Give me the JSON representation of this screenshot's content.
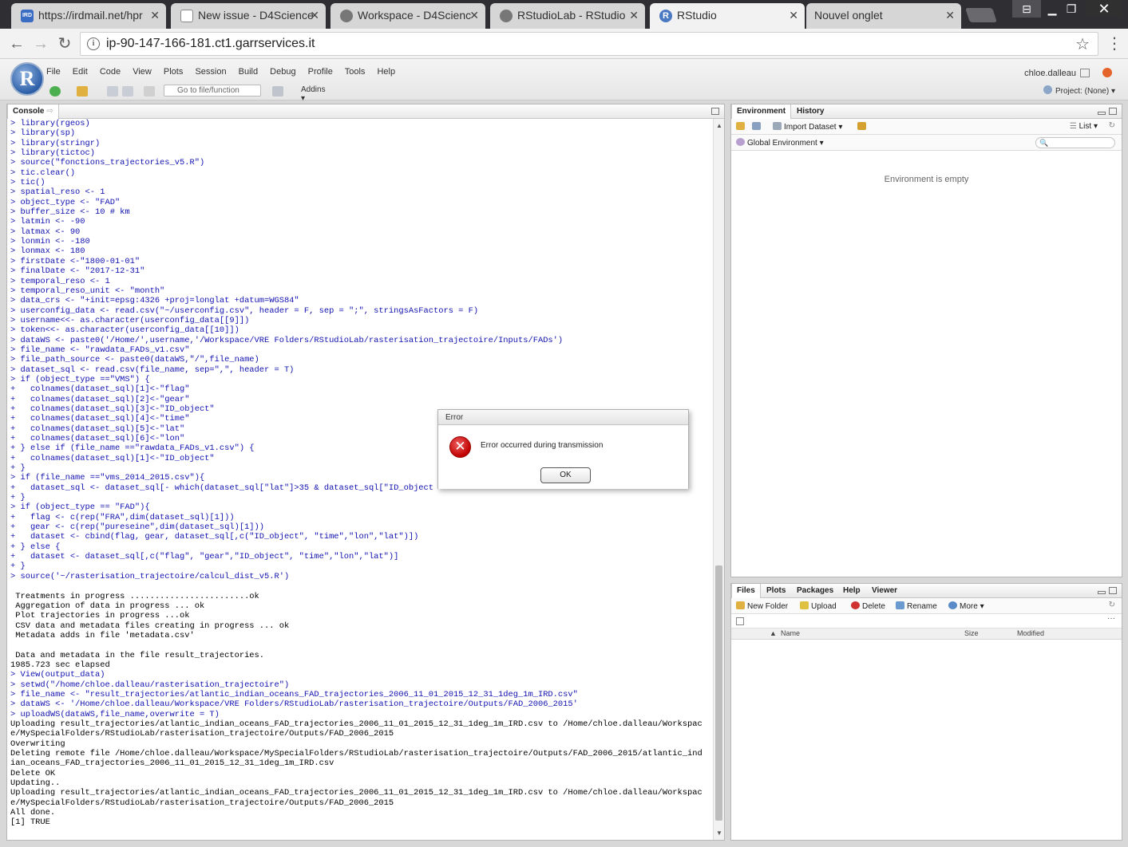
{
  "browser": {
    "tabs": [
      {
        "title": "https://irdmail.net/hpr",
        "icon_color": "#3b6cc4",
        "icon_text": "IRD"
      },
      {
        "title": "New issue - D4Science",
        "icon_color": "#ffffff",
        "icon_text": ""
      },
      {
        "title": "Workspace - D4Scienc",
        "icon_color": "#777777",
        "icon_text": ""
      },
      {
        "title": "RStudioLab - RStudio",
        "icon_color": "#777777",
        "icon_text": ""
      },
      {
        "title": "RStudio",
        "icon_color": "#4a78c2",
        "icon_text": "R"
      },
      {
        "title": "Nouvel onglet",
        "icon_color": "",
        "icon_text": ""
      }
    ],
    "url": "ip-90-147-166-181.ct1.garrservices.it"
  },
  "rstudio": {
    "logo": "R",
    "menu": [
      "File",
      "Edit",
      "Code",
      "View",
      "Plots",
      "Session",
      "Build",
      "Debug",
      "Profile",
      "Tools",
      "Help"
    ],
    "goto_placeholder": "Go to file/function",
    "addins": "Addins",
    "user": "chloe.dalleau",
    "project": "Project: (None)",
    "console_tab": "Console",
    "env_tabs": [
      "Environment",
      "History"
    ],
    "import_dataset": "Import Dataset",
    "list_view": "List",
    "global_env": "Global Environment",
    "env_empty": "Environment is empty",
    "files_tabs": [
      "Files",
      "Plots",
      "Packages",
      "Help",
      "Viewer"
    ],
    "files_toolbar": {
      "new_folder": "New Folder",
      "upload": "Upload",
      "delete": "Delete",
      "rename": "Rename",
      "more": "More"
    },
    "files_columns": {
      "name": "Name",
      "size": "Size",
      "modified": "Modified"
    }
  },
  "console_lines": [
    {
      "t": "> library(rgeos)",
      "c": 1
    },
    {
      "t": "> library(sp)",
      "c": 1
    },
    {
      "t": "> library(stringr)",
      "c": 1
    },
    {
      "t": "> library(tictoc)",
      "c": 1
    },
    {
      "t": "> source(\"fonctions_trajectories_v5.R\")",
      "c": 1
    },
    {
      "t": "> tic.clear()",
      "c": 1
    },
    {
      "t": "> tic()",
      "c": 1
    },
    {
      "t": "> spatial_reso <- 1",
      "c": 1
    },
    {
      "t": "> object_type <- \"FAD\"",
      "c": 1
    },
    {
      "t": "> buffer_size <- 10 # km",
      "c": 1
    },
    {
      "t": "> latmin <- -90",
      "c": 1
    },
    {
      "t": "> latmax <- 90",
      "c": 1
    },
    {
      "t": "> lonmin <- -180",
      "c": 1
    },
    {
      "t": "> lonmax <- 180",
      "c": 1
    },
    {
      "t": "> firstDate <-\"1800-01-01\"",
      "c": 1
    },
    {
      "t": "> finalDate <- \"2017-12-31\"",
      "c": 1
    },
    {
      "t": "> temporal_reso <- 1",
      "c": 1
    },
    {
      "t": "> temporal_reso_unit <- \"month\"",
      "c": 1
    },
    {
      "t": "> data_crs <- \"+init=epsg:4326 +proj=longlat +datum=WGS84\"",
      "c": 1
    },
    {
      "t": "> userconfig_data <- read.csv(\"~/userconfig.csv\", header = F, sep = \";\", stringsAsFactors = F)",
      "c": 1
    },
    {
      "t": "> username<<- as.character(userconfig_data[[9]])",
      "c": 1
    },
    {
      "t": "> token<<- as.character(userconfig_data[[10]])",
      "c": 1
    },
    {
      "t": "> dataWS <- paste0('/Home/',username,'/Workspace/VRE Folders/RStudioLab/rasterisation_trajectoire/Inputs/FADs')",
      "c": 1
    },
    {
      "t": "> file_name <- \"rawdata_FADs_v1.csv\"",
      "c": 1
    },
    {
      "t": "> file_path_source <- paste0(dataWS,\"/\",file_name)",
      "c": 1
    },
    {
      "t": "> dataset_sql <- read.csv(file_name, sep=\",\", header = T)",
      "c": 1
    },
    {
      "t": "> if (object_type ==\"VMS\") {",
      "c": 1
    },
    {
      "t": "+   colnames(dataset_sql)[1]<-\"flag\"",
      "c": 1
    },
    {
      "t": "+   colnames(dataset_sql)[2]<-\"gear\"",
      "c": 1
    },
    {
      "t": "+   colnames(dataset_sql)[3]<-\"ID_object\"",
      "c": 1
    },
    {
      "t": "+   colnames(dataset_sql)[4]<-\"time\"",
      "c": 1
    },
    {
      "t": "+   colnames(dataset_sql)[5]<-\"lat\"",
      "c": 1
    },
    {
      "t": "+   colnames(dataset_sql)[6]<-\"lon\"",
      "c": 1
    },
    {
      "t": "+ } else if (file_name ==\"rawdata_FADs_v1.csv\") {",
      "c": 1
    },
    {
      "t": "+   colnames(dataset_sql)[1]<-\"ID_object\"",
      "c": 1
    },
    {
      "t": "+ }",
      "c": 1
    },
    {
      "t": "> if (file_name ==\"vms_2014_2015.csv\"){",
      "c": 1
    },
    {
      "t": "+   dataset_sql <- dataset_sql[- which(dataset_sql[\"lat\"]>35 & dataset_sql[\"ID_object",
      "c": 1
    },
    {
      "t": "+ }",
      "c": 1
    },
    {
      "t": "> if (object_type == \"FAD\"){",
      "c": 1
    },
    {
      "t": "+   flag <- c(rep(\"FRA\",dim(dataset_sql)[1]))",
      "c": 1
    },
    {
      "t": "+   gear <- c(rep(\"pureseine\",dim(dataset_sql)[1]))",
      "c": 1
    },
    {
      "t": "+   dataset <- cbind(flag, gear, dataset_sql[,c(\"ID_object\", \"time\",\"lon\",\"lat\")])",
      "c": 1
    },
    {
      "t": "+ } else {",
      "c": 1
    },
    {
      "t": "+   dataset <- dataset_sql[,c(\"flag\", \"gear\",\"ID_object\", \"time\",\"lon\",\"lat\")]",
      "c": 1
    },
    {
      "t": "+ }",
      "c": 1
    },
    {
      "t": "> source('~/rasterisation_trajectoire/calcul_dist_v5.R')",
      "c": 1
    },
    {
      "t": "",
      "c": 0
    },
    {
      "t": " Treatments in progress ........................ok",
      "c": 0
    },
    {
      "t": " Aggregation of data in progress ... ok",
      "c": 0
    },
    {
      "t": " Plot trajectories in progress ...ok",
      "c": 0
    },
    {
      "t": " CSV data and metadata files creating in progress ... ok",
      "c": 0
    },
    {
      "t": " Metadata adds in file 'metadata.csv'",
      "c": 0
    },
    {
      "t": "",
      "c": 0
    },
    {
      "t": " Data and metadata in the file result_trajectories.",
      "c": 0
    },
    {
      "t": "1985.723 sec elapsed",
      "c": 0
    },
    {
      "t": "> View(output_data)",
      "c": 1
    },
    {
      "t": "> setwd(\"/home/chloe.dalleau/rasterisation_trajectoire\")",
      "c": 1
    },
    {
      "t": "> file_name <- \"result_trajectories/atlantic_indian_oceans_FAD_trajectories_2006_11_01_2015_12_31_1deg_1m_IRD.csv\"",
      "c": 1
    },
    {
      "t": "> dataWS <- '/Home/chloe.dalleau/Workspace/VRE Folders/RStudioLab/rasterisation_trajectoire/Outputs/FAD_2006_2015'",
      "c": 1
    },
    {
      "t": "> uploadWS(dataWS,file_name,overwrite = T)",
      "c": 1
    },
    {
      "t": "Uploading result_trajectories/atlantic_indian_oceans_FAD_trajectories_2006_11_01_2015_12_31_1deg_1m_IRD.csv to /Home/chloe.dalleau/Workspac",
      "c": 0
    },
    {
      "t": "e/MySpecialFolders/RStudioLab/rasterisation_trajectoire/Outputs/FAD_2006_2015",
      "c": 0
    },
    {
      "t": "Overwriting",
      "c": 0
    },
    {
      "t": "Deleting remote file /Home/chloe.dalleau/Workspace/MySpecialFolders/RStudioLab/rasterisation_trajectoire/Outputs/FAD_2006_2015/atlantic_ind",
      "c": 0
    },
    {
      "t": "ian_oceans_FAD_trajectories_2006_11_01_2015_12_31_1deg_1m_IRD.csv",
      "c": 0
    },
    {
      "t": "Delete OK",
      "c": 0
    },
    {
      "t": "Updating..",
      "c": 0
    },
    {
      "t": "Uploading result_trajectories/atlantic_indian_oceans_FAD_trajectories_2006_11_01_2015_12_31_1deg_1m_IRD.csv to /Home/chloe.dalleau/Workspac",
      "c": 0
    },
    {
      "t": "e/MySpecialFolders/RStudioLab/rasterisation_trajectoire/Outputs/FAD_2006_2015",
      "c": 0
    },
    {
      "t": "All done.",
      "c": 0
    },
    {
      "t": "[1] TRUE",
      "c": 0
    }
  ],
  "dialog": {
    "title": "Error",
    "message": "Error occurred during transmission",
    "ok": "OK"
  },
  "colors": {
    "command_blue": "#1010b0",
    "error_red": "#c00000",
    "chrome_dark": "#2f2f33"
  }
}
